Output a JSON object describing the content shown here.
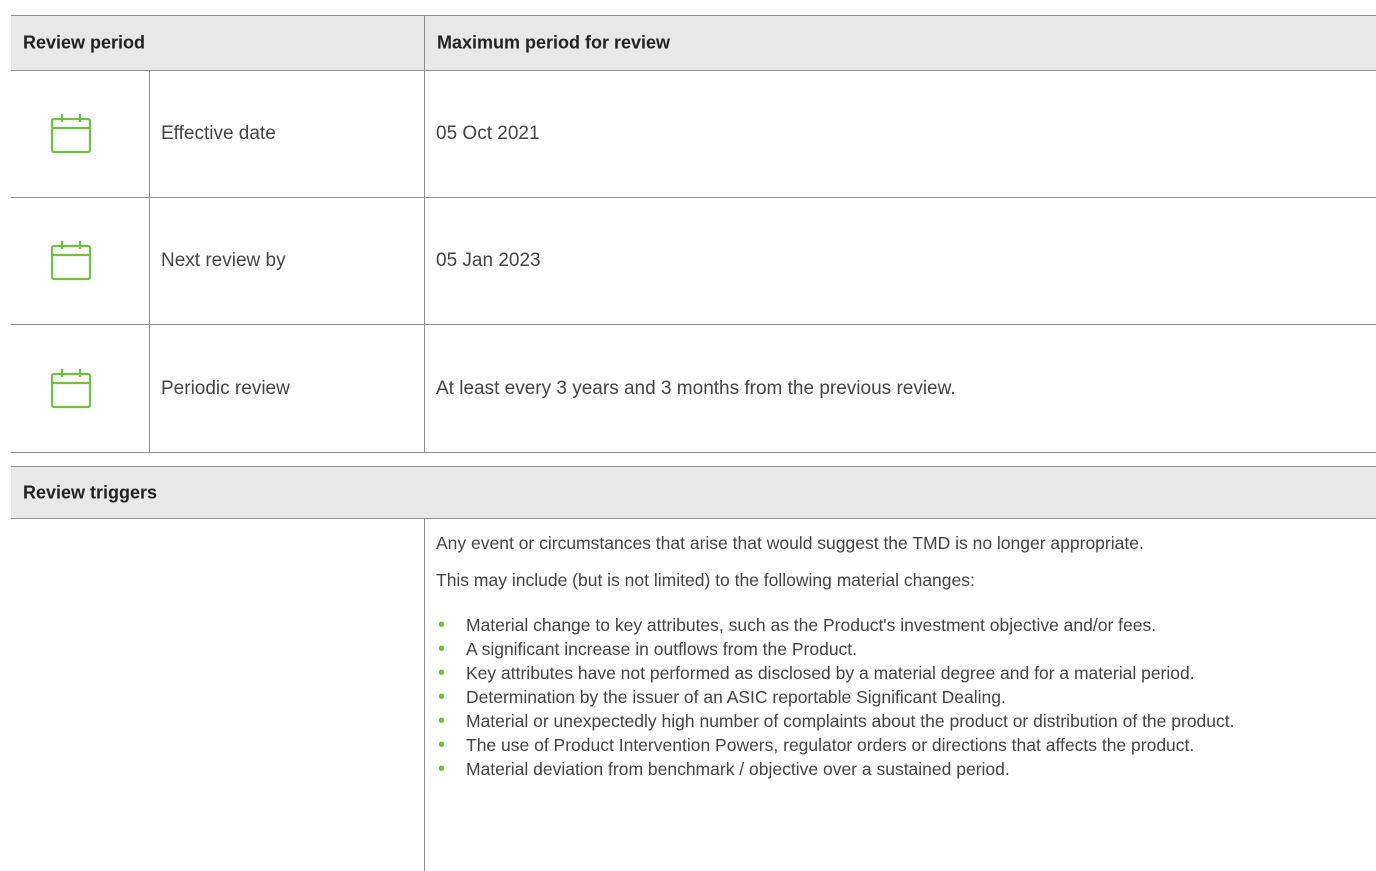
{
  "review_period": {
    "header_left": "Review period",
    "header_right": "Maximum period for review",
    "rows": [
      {
        "icon": "calendar-icon",
        "label": "Effective date",
        "value": "05 Oct 2021"
      },
      {
        "icon": "calendar-icon",
        "label": "Next review by",
        "value": "05 Jan 2023"
      },
      {
        "icon": "calendar-icon",
        "label": "Periodic review",
        "value": "At least every 3 years and 3 months from the previous review."
      }
    ]
  },
  "review_triggers": {
    "header": "Review triggers",
    "intro": [
      "Any event or circumstances that arise that would suggest the TMD is no longer appropriate.",
      "This may include (but is not limited) to the following material changes:"
    ],
    "items": [
      "Material change to key attributes, such as the Product's investment objective and/or fees.",
      "A significant increase in outflows from the Product.",
      "Key attributes have not performed as disclosed by a material degree and for a material period.",
      "Determination by the issuer of an ASIC reportable Significant Dealing.",
      "Material or unexpectedly high number of complaints about the product or distribution of the product.",
      "The use of Product Intervention Powers, regulator orders or directions that affects the product.",
      "Material deviation from benchmark / objective over a sustained period."
    ]
  },
  "colors": {
    "accent": "#72c042",
    "header_bg": "#e8e8e8",
    "border": "#8f8f8f"
  }
}
